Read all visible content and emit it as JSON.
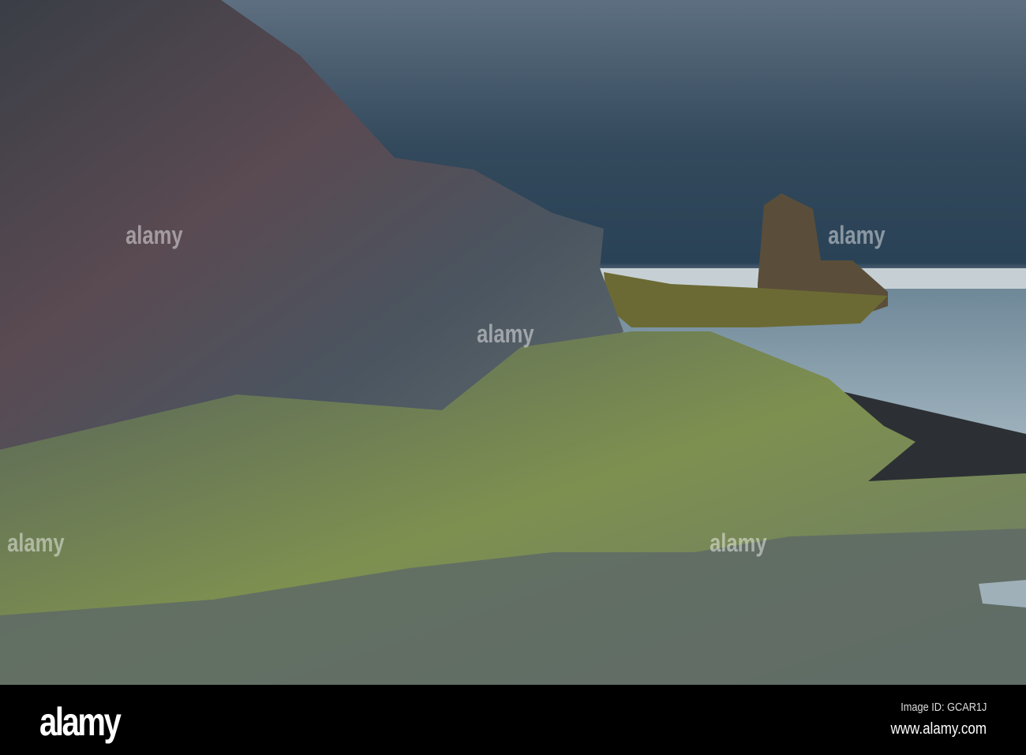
{
  "photo": {
    "subject": "rocky coastline with sea stack under cloudy sky"
  },
  "watermark": {
    "brand": "alamy"
  },
  "footer": {
    "logo": "alamy",
    "image_id": "Image ID: GCAR1J",
    "url": "www.alamy.com"
  },
  "colors": {
    "sky": "#3c5468",
    "sea": "#7f97a6",
    "rock": "#4b5560",
    "moss": "#8a9a4a"
  }
}
